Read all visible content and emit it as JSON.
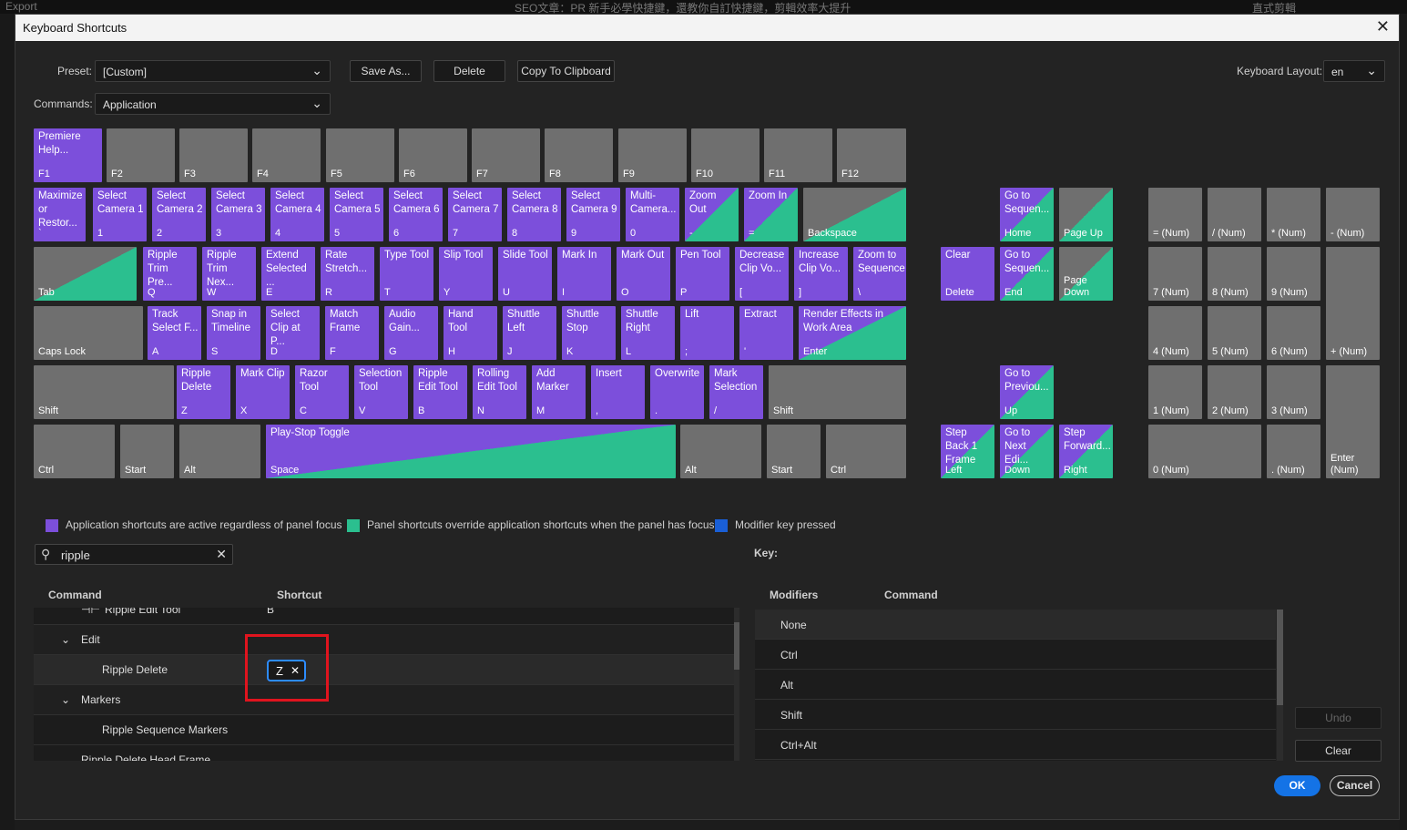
{
  "background": {
    "left": "Export",
    "center": "SEO文章：PR 新手必學快捷鍵，還教你自訂快捷鍵，剪輯效率大提升",
    "right": "直式剪輯"
  },
  "dialog": {
    "title": "Keyboard Shortcuts",
    "close": "✕"
  },
  "preset": {
    "label": "Preset:",
    "value": "[Custom]"
  },
  "commands": {
    "label": "Commands:",
    "value": "Application"
  },
  "buttons": {
    "save_as": "Save As...",
    "delete": "Delete",
    "copy": "Copy To Clipboard",
    "undo": "Undo",
    "clear": "Clear",
    "ok": "OK",
    "cancel": "Cancel"
  },
  "layout": {
    "label": "Keyboard Layout:",
    "value": "en"
  },
  "colors": {
    "application": "#7c4fdb",
    "panel": "#2bbf8f",
    "modifier": "#1a5fd6",
    "unassigned": "#6f6f6f"
  },
  "keys": [
    {
      "t": "app",
      "c": "Premiere Help...",
      "k": "F1"
    },
    {
      "t": "",
      "c": "",
      "k": "F2"
    },
    {
      "t": "",
      "c": "",
      "k": "F3"
    },
    {
      "t": "",
      "c": "",
      "k": "F4"
    },
    {
      "t": "",
      "c": "",
      "k": "F5"
    },
    {
      "t": "",
      "c": "",
      "k": "F6"
    },
    {
      "t": "",
      "c": "",
      "k": "F7"
    },
    {
      "t": "",
      "c": "",
      "k": "F8"
    },
    {
      "t": "",
      "c": "",
      "k": "F9"
    },
    {
      "t": "",
      "c": "",
      "k": "F10"
    },
    {
      "t": "",
      "c": "",
      "k": "F11"
    },
    {
      "t": "",
      "c": "",
      "k": "F12"
    },
    {
      "t": "app",
      "c": "Maximize or Restor...",
      "k": "`"
    },
    {
      "t": "app",
      "c": "Select Camera 1",
      "k": "1"
    },
    {
      "t": "app",
      "c": "Select Camera 2",
      "k": "2"
    },
    {
      "t": "app",
      "c": "Select Camera 3",
      "k": "3"
    },
    {
      "t": "app",
      "c": "Select Camera 4",
      "k": "4"
    },
    {
      "t": "app",
      "c": "Select Camera 5",
      "k": "5"
    },
    {
      "t": "app",
      "c": "Select Camera 6",
      "k": "6"
    },
    {
      "t": "app",
      "c": "Select Camera 7",
      "k": "7"
    },
    {
      "t": "app",
      "c": "Select Camera 8",
      "k": "8"
    },
    {
      "t": "app",
      "c": "Select Camera 9",
      "k": "9"
    },
    {
      "t": "app",
      "c": "Multi-Camera...",
      "k": "0"
    },
    {
      "t": "mix",
      "c": "Zoom Out",
      "k": "-"
    },
    {
      "t": "mix",
      "c": "Zoom In",
      "k": "="
    },
    {
      "t": "gmix",
      "c": "",
      "k": "Backspace"
    },
    {
      "t": "gmix",
      "c": "",
      "k": "Tab"
    },
    {
      "t": "app",
      "c": "Ripple Trim Pre...",
      "k": "Q"
    },
    {
      "t": "app",
      "c": "Ripple Trim Nex...",
      "k": "W"
    },
    {
      "t": "app",
      "c": "Extend Selected ...",
      "k": "E"
    },
    {
      "t": "app",
      "c": "Rate Stretch...",
      "k": "R"
    },
    {
      "t": "app",
      "c": "Type Tool",
      "k": "T"
    },
    {
      "t": "app",
      "c": "Slip Tool",
      "k": "Y"
    },
    {
      "t": "app",
      "c": "Slide Tool",
      "k": "U"
    },
    {
      "t": "app",
      "c": "Mark In",
      "k": "I"
    },
    {
      "t": "app",
      "c": "Mark Out",
      "k": "O"
    },
    {
      "t": "app",
      "c": "Pen Tool",
      "k": "P"
    },
    {
      "t": "app",
      "c": "Decrease Clip Vo...",
      "k": "["
    },
    {
      "t": "app",
      "c": "Increase Clip Vo...",
      "k": "]"
    },
    {
      "t": "app",
      "c": "Zoom to Sequence",
      "k": "\\"
    },
    {
      "t": "",
      "c": "",
      "k": "Caps Lock"
    },
    {
      "t": "app",
      "c": "Track Select F...",
      "k": "A"
    },
    {
      "t": "app",
      "c": "Snap in Timeline",
      "k": "S"
    },
    {
      "t": "app",
      "c": "Select Clip at P...",
      "k": "D"
    },
    {
      "t": "app",
      "c": "Match Frame",
      "k": "F"
    },
    {
      "t": "app",
      "c": "Audio Gain...",
      "k": "G"
    },
    {
      "t": "app",
      "c": "Hand Tool",
      "k": "H"
    },
    {
      "t": "app",
      "c": "Shuttle Left",
      "k": "J"
    },
    {
      "t": "app",
      "c": "Shuttle Stop",
      "k": "K"
    },
    {
      "t": "app",
      "c": "Shuttle Right",
      "k": "L"
    },
    {
      "t": "app",
      "c": "Lift",
      "k": ";"
    },
    {
      "t": "app",
      "c": "Extract",
      "k": "'"
    },
    {
      "t": "mix",
      "c": "Render Effects in Work Area",
      "k": "Enter"
    },
    {
      "t": "",
      "c": "",
      "k": "Shift"
    },
    {
      "t": "app",
      "c": "Ripple Delete",
      "k": "Z"
    },
    {
      "t": "app",
      "c": "Mark Clip",
      "k": "X"
    },
    {
      "t": "app",
      "c": "Razor Tool",
      "k": "C"
    },
    {
      "t": "app",
      "c": "Selection Tool",
      "k": "V"
    },
    {
      "t": "app",
      "c": "Ripple Edit Tool",
      "k": "B"
    },
    {
      "t": "app",
      "c": "Rolling Edit Tool",
      "k": "N"
    },
    {
      "t": "app",
      "c": "Add Marker",
      "k": "M"
    },
    {
      "t": "app",
      "c": "Insert",
      "k": ","
    },
    {
      "t": "app",
      "c": "Overwrite",
      "k": "."
    },
    {
      "t": "app",
      "c": "Mark Selection",
      "k": "/"
    },
    {
      "t": "",
      "c": "",
      "k": "Shift"
    },
    {
      "t": "",
      "c": "",
      "k": "Ctrl"
    },
    {
      "t": "",
      "c": "",
      "k": "Start"
    },
    {
      "t": "",
      "c": "",
      "k": "Alt"
    },
    {
      "t": "mix",
      "c": "Play-Stop Toggle",
      "k": "Space"
    },
    {
      "t": "",
      "c": "",
      "k": "Alt"
    },
    {
      "t": "",
      "c": "",
      "k": "Start"
    },
    {
      "t": "",
      "c": "",
      "k": "Ctrl"
    },
    {
      "t": "mix",
      "c": "Go to Sequen...",
      "k": "Home"
    },
    {
      "t": "gmix",
      "c": "",
      "k": "Page Up"
    },
    {
      "t": "app",
      "c": "Clear",
      "k": "Delete"
    },
    {
      "t": "mix",
      "c": "Go to Sequen...",
      "k": "End"
    },
    {
      "t": "gmix",
      "c": "",
      "k": "Page Down"
    },
    {
      "t": "mix",
      "c": "Go to Previou...",
      "k": "Up"
    },
    {
      "t": "mix",
      "c": "Step Back 1 Frame",
      "k": "Left"
    },
    {
      "t": "mix",
      "c": "Go to Next Edi...",
      "k": "Down"
    },
    {
      "t": "mix",
      "c": "Step Forward...",
      "k": "Right"
    },
    {
      "t": "",
      "c": "",
      "k": "= (Num)"
    },
    {
      "t": "",
      "c": "",
      "k": "/ (Num)"
    },
    {
      "t": "",
      "c": "",
      "k": "* (Num)"
    },
    {
      "t": "",
      "c": "",
      "k": "- (Num)"
    },
    {
      "t": "",
      "c": "",
      "k": "7 (Num)"
    },
    {
      "t": "",
      "c": "",
      "k": "8 (Num)"
    },
    {
      "t": "",
      "c": "",
      "k": "9 (Num)"
    },
    {
      "t": "",
      "c": "",
      "k": "+ (Num)"
    },
    {
      "t": "",
      "c": "",
      "k": "4 (Num)"
    },
    {
      "t": "",
      "c": "",
      "k": "5 (Num)"
    },
    {
      "t": "",
      "c": "",
      "k": "6 (Num)"
    },
    {
      "t": "",
      "c": "",
      "k": "1 (Num)"
    },
    {
      "t": "",
      "c": "",
      "k": "2 (Num)"
    },
    {
      "t": "",
      "c": "",
      "k": "3 (Num)"
    },
    {
      "t": "",
      "c": "",
      "k": "Enter (Num)"
    },
    {
      "t": "",
      "c": "",
      "k": "0 (Num)"
    },
    {
      "t": "",
      "c": "",
      "k": ". (Num)"
    }
  ],
  "legend": {
    "app": "Application shortcuts are active regardless of panel focus",
    "panel": "Panel shortcuts override application shortcuts when the panel has focus",
    "modifier": "Modifier key pressed"
  },
  "search": {
    "value": "ripple",
    "icon": "search-icon",
    "clear": "✕"
  },
  "key_panel_label": "Key:",
  "table": {
    "headers": {
      "command": "Command",
      "shortcut": "Shortcut"
    },
    "rows": [
      {
        "name": "Ripple Edit Tool",
        "shortcut": "B"
      },
      {
        "name": "Edit",
        "shortcut": ""
      },
      {
        "name": "Ripple Delete",
        "shortcut": ""
      },
      {
        "name": "Markers",
        "shortcut": ""
      },
      {
        "name": "Ripple Sequence Markers",
        "shortcut": ""
      },
      {
        "name": "Ripple Delete Head Frame",
        "shortcut": ""
      }
    ],
    "chip": {
      "key": "Z",
      "remove": "✕"
    }
  },
  "modifiers": {
    "headers": {
      "modifiers": "Modifiers",
      "command": "Command"
    },
    "rows": [
      "None",
      "Ctrl",
      "Alt",
      "Shift",
      "Ctrl+Alt"
    ]
  }
}
